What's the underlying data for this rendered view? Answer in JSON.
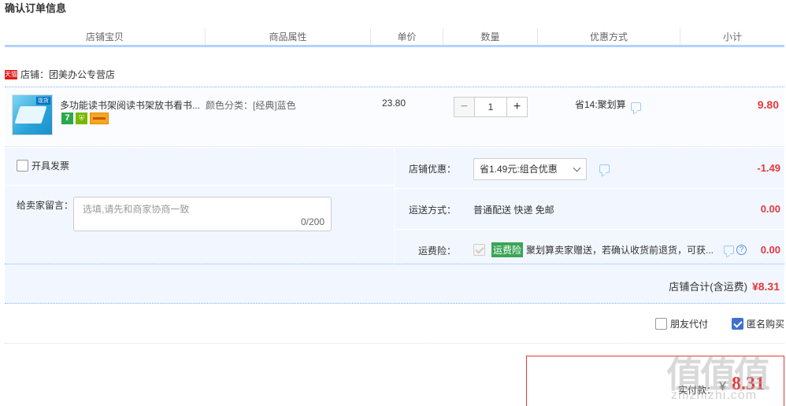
{
  "page": {
    "title": "确认订单信息"
  },
  "columns": [
    "店铺宝贝",
    "商品属性",
    "单价",
    "数量",
    "优惠方式",
    "小计"
  ],
  "shop": {
    "badge": "天猫",
    "name": "店铺：团美办公专营店"
  },
  "item": {
    "thumb_tag": "现货",
    "title": "多功能读书架阅读书架放书看书...",
    "icon_7": "7",
    "sku": "颜色分类：[经典]蓝色",
    "price": "23.80",
    "qty_minus": "−",
    "qty": "1",
    "qty_plus": "+",
    "promo": "省14:聚划算",
    "subtotal": "9.80"
  },
  "options": {
    "invoice_label": "开具发票",
    "message_label": "给卖家留言：",
    "message_placeholder": "选填,请先和商家协商一致",
    "message_count": "0/200",
    "shop_discount_label": "店铺优惠：",
    "shop_discount_value": "省1.49元:组合优惠",
    "shop_discount_amount": "-1.49",
    "shipping_label": "运送方式：",
    "shipping_value": "普通配送 快递 免邮",
    "shipping_amount": "0.00",
    "insurance_label": "运费险：",
    "insurance_tag": "运费险",
    "insurance_text": "聚划算卖家赠送，若确认收货前退货，可获...",
    "insurance_amount": "0.00",
    "help_glyph": "?"
  },
  "shop_total": {
    "label": "店铺合计(含运费)",
    "amount": "¥8.31"
  },
  "extras": {
    "friend_pay": "朋友代付",
    "anonymous": "匿名购买"
  },
  "payment": {
    "label": "实付款：",
    "currency": "¥",
    "amount": "8.31"
  },
  "watermark": {
    "big": "值值值",
    "small": "zhizhizhi.com"
  },
  "colors": {
    "accent": "#e4393c",
    "header_line": "#b2d1ff",
    "panel": "#f2f7ff",
    "checkbox": "#3f6fd1"
  }
}
